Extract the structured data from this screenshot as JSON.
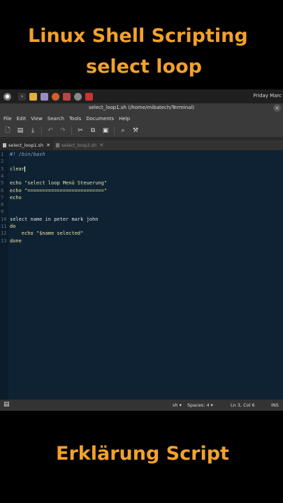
{
  "captions": {
    "title_line1": "Linux Shell Scripting",
    "title_line2": "select loop",
    "bottom": "Erklärung Script"
  },
  "topbar": {
    "clock": "Friday Marc",
    "icons": [
      "mint-menu-icon",
      "terminal-icon",
      "folder-icon",
      "files-icon",
      "firefox-icon",
      "app-icon",
      "settings-icon",
      "app2-icon"
    ]
  },
  "window": {
    "title": "select_loop1.sh (/home/mibatech/Terminal)",
    "close": "×"
  },
  "menu": [
    "File",
    "Edit",
    "View",
    "Search",
    "Tools",
    "Documents",
    "Help"
  ],
  "tabs": [
    {
      "label": "select_loop1.sh",
      "close": "✕",
      "active": true
    },
    {
      "label": "select_loop2.sh",
      "close": "✕",
      "active": false
    }
  ],
  "editor": {
    "line_numbers": [
      "1",
      "2",
      "3",
      "4",
      "5",
      "6",
      "7",
      "8",
      "9",
      "10",
      "11",
      "12",
      "13"
    ],
    "lines": [
      "#! /bin/bash",
      "",
      "clear",
      "",
      "echo \"select loop Menü Steuerung\"",
      "echo \"==========================\"",
      "echo",
      "",
      "",
      "select name in peter mark john",
      "do",
      "    echo \"$name selected\"",
      "done"
    ]
  },
  "status": {
    "language": "sh",
    "spaces": "Spaces: 4",
    "position": "Ln 3, Col 6",
    "mode": "INS"
  }
}
